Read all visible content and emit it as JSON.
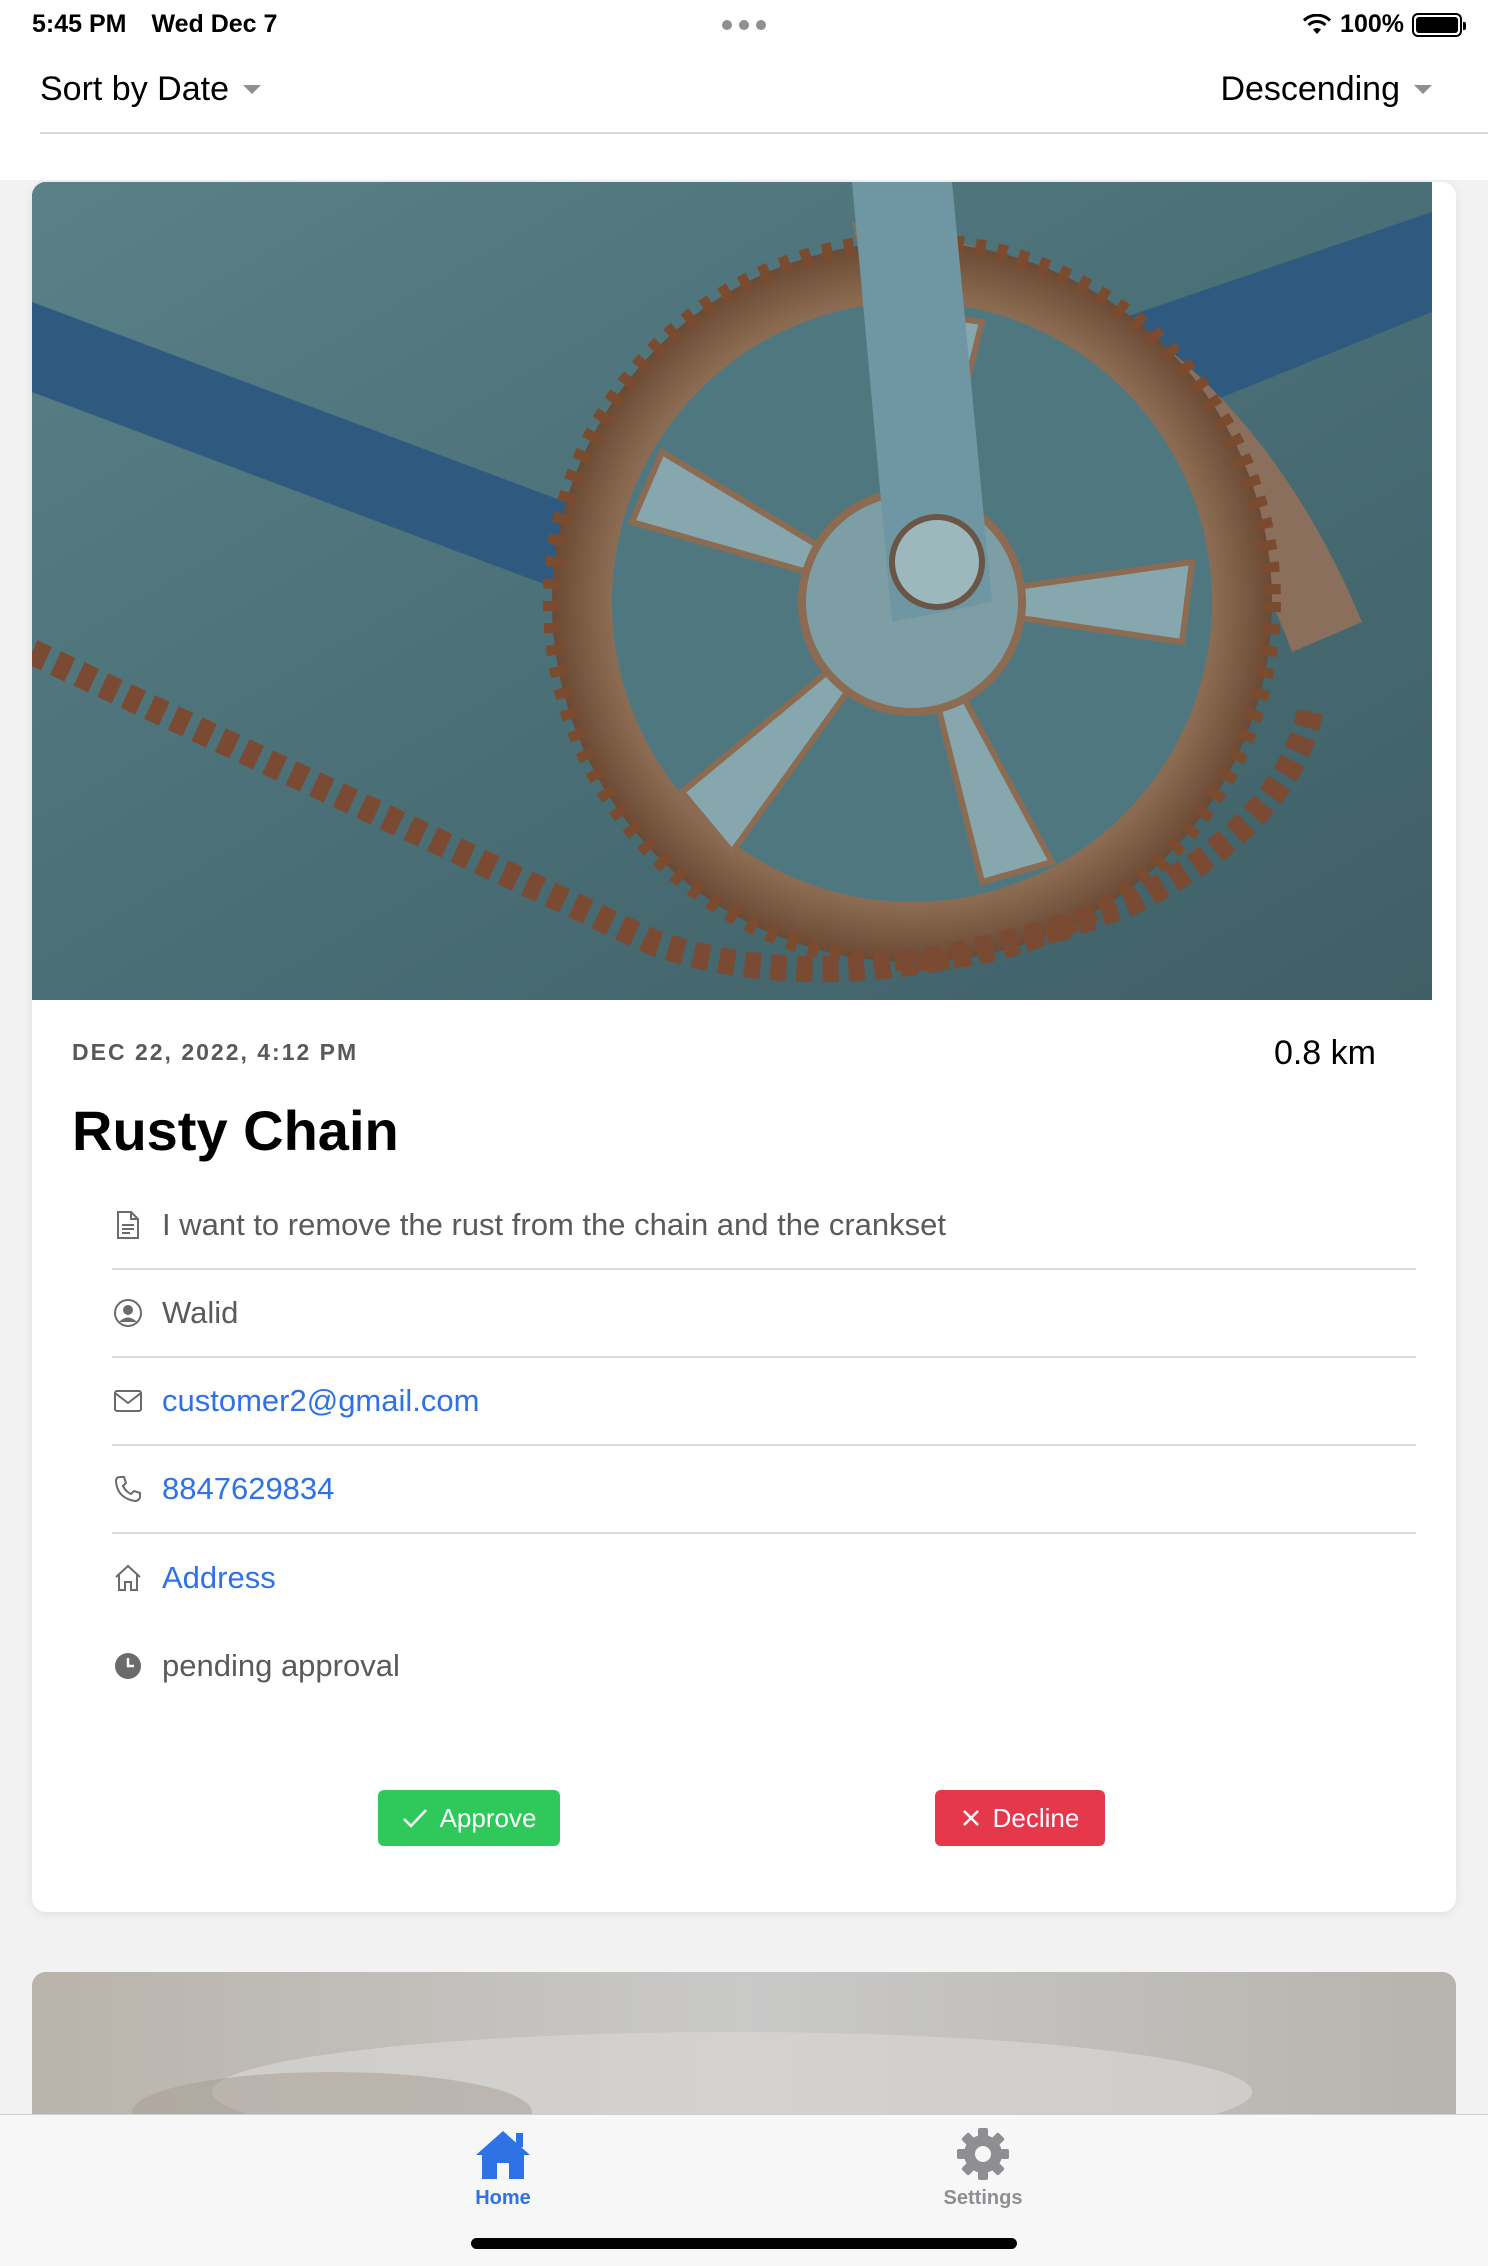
{
  "status_bar": {
    "time": "5:45 PM",
    "date": "Wed Dec 7",
    "battery": "100%"
  },
  "sort": {
    "sort_by": "Sort by Date",
    "order": "Descending"
  },
  "request": {
    "image": "rusty-bicycle-chain-photo",
    "date": "DEC 22, 2022, 4:12 PM",
    "distance": "0.8 km",
    "title": "Rusty Chain",
    "description": "I want to remove the rust from the chain and the crankset",
    "customer_name": "Walid",
    "email": "customer2@gmail.com",
    "phone": "8847629834",
    "address": "Address",
    "status": "pending approval",
    "approve_label": "Approve",
    "decline_label": "Decline"
  },
  "tabs": {
    "home": "Home",
    "settings": "Settings"
  },
  "colors": {
    "accent": "#2f72e6",
    "approve": "#2fc85b",
    "decline": "#e5384b"
  }
}
